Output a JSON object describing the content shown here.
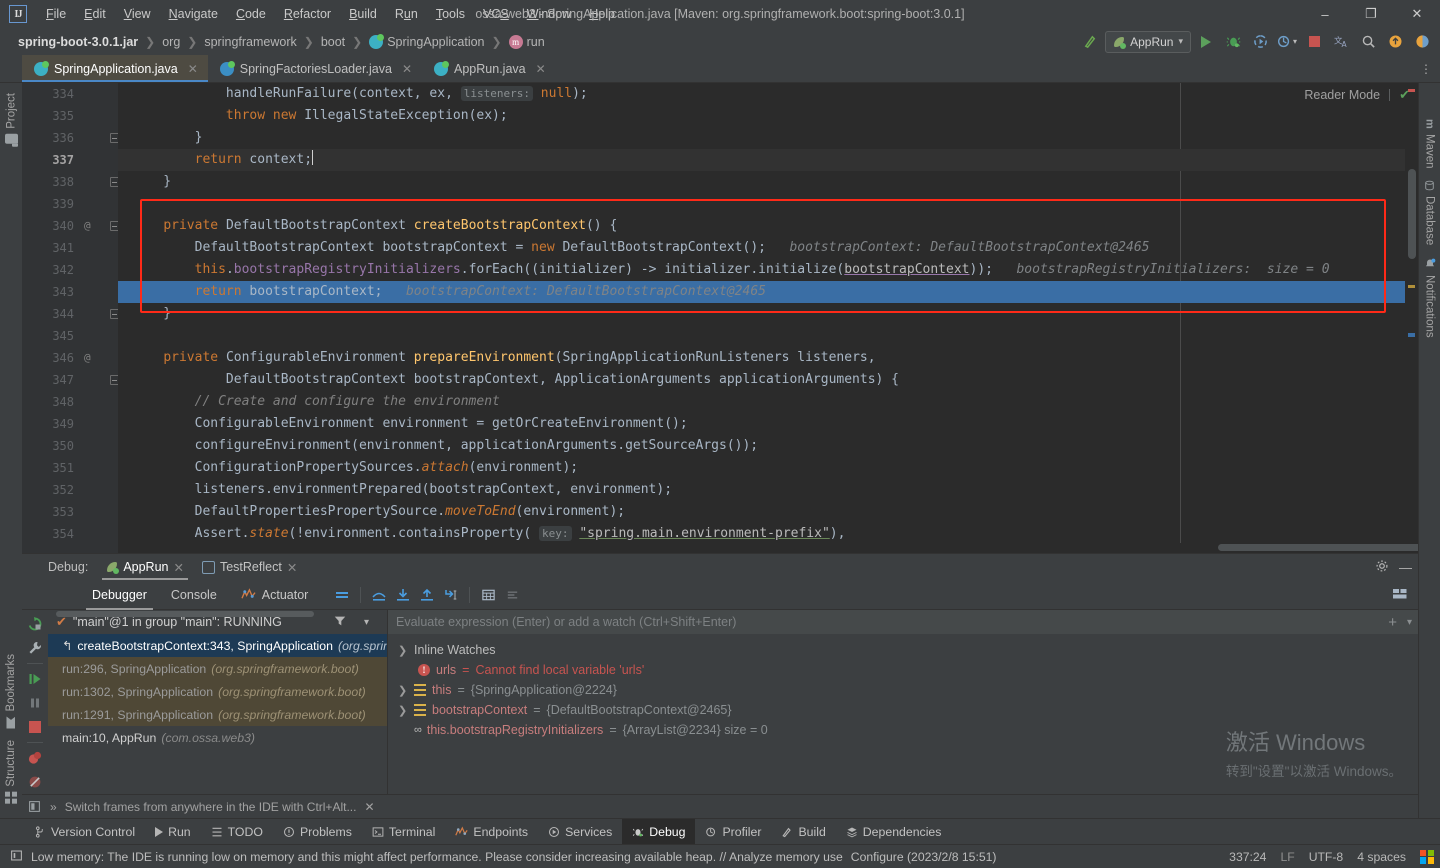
{
  "window": {
    "title": "ossa-web3 - SpringApplication.java [Maven: org.springframework.boot:spring-boot:3.0.1]",
    "logo": "IJ",
    "minimize": "–",
    "maximize": "❐",
    "close": "✕"
  },
  "menu": [
    {
      "label": "File",
      "mnemonic": "F"
    },
    {
      "label": "Edit",
      "mnemonic": "E"
    },
    {
      "label": "View",
      "mnemonic": "V"
    },
    {
      "label": "Navigate",
      "mnemonic": "N"
    },
    {
      "label": "Code",
      "mnemonic": "C"
    },
    {
      "label": "Refactor",
      "mnemonic": "R"
    },
    {
      "label": "Build",
      "mnemonic": "B"
    },
    {
      "label": "Run",
      "mnemonic": "u"
    },
    {
      "label": "Tools",
      "mnemonic": "T"
    },
    {
      "label": "VCS",
      "mnemonic": "S"
    },
    {
      "label": "Window",
      "mnemonic": "W"
    },
    {
      "label": "Help",
      "mnemonic": "H"
    }
  ],
  "breadcrumbs": [
    {
      "label": "spring-boot-3.0.1.jar",
      "icon": "",
      "bold": true
    },
    {
      "label": "org",
      "icon": ""
    },
    {
      "label": "springframework",
      "icon": ""
    },
    {
      "label": "boot",
      "icon": ""
    },
    {
      "label": "SpringApplication",
      "icon": "class-icon"
    },
    {
      "label": "run",
      "icon": "method-icon"
    }
  ],
  "toolbar": {
    "run_config": "AppRun",
    "dropdown_caret": "▾",
    "icons": [
      "build-hammer-icon",
      "run-icon",
      "debug-icon",
      "run-with-coverage-icon",
      "profiler-icon",
      "stop-icon",
      "translate-icon",
      "search-icon",
      "updates-icon",
      "ai-assistant-icon"
    ]
  },
  "editor_tabs": [
    {
      "label": "SpringApplication.java",
      "icon": "class-icon",
      "active": true,
      "close": "✕"
    },
    {
      "label": "SpringFactoriesLoader.java",
      "icon": "class-icon-blue",
      "active": false,
      "close": "✕"
    },
    {
      "label": "AppRun.java",
      "icon": "runnable-class-icon",
      "active": false,
      "close": "✕"
    }
  ],
  "editor": {
    "reader_mode": "Reader Mode",
    "reader_mode_check": "✔",
    "lines": [
      {
        "num": "334",
        "at": false,
        "fold": false,
        "segs": [
          {
            "t": "            handleRunFailure(context, ex, ",
            "c": "nrm"
          },
          {
            "t": "listeners:",
            "c": "param-hint"
          },
          {
            "t": " ",
            "c": "nrm"
          },
          {
            "t": "null",
            "c": "kw"
          },
          {
            "t": ");",
            "c": "nrm"
          }
        ]
      },
      {
        "num": "335",
        "at": false,
        "fold": false,
        "segs": [
          {
            "t": "            ",
            "c": "nrm"
          },
          {
            "t": "throw new ",
            "c": "kw"
          },
          {
            "t": "IllegalStateException(ex);",
            "c": "nrm"
          }
        ]
      },
      {
        "num": "336",
        "at": false,
        "fold": "end",
        "segs": [
          {
            "t": "        }",
            "c": "nrm"
          }
        ]
      },
      {
        "num": "337",
        "at": false,
        "fold": false,
        "current": true,
        "segs": [
          {
            "t": "        ",
            "c": "nrm"
          },
          {
            "t": "return ",
            "c": "kw"
          },
          {
            "t": "context;",
            "c": "nrm"
          },
          {
            "t": "|",
            "c": "caret"
          }
        ]
      },
      {
        "num": "338",
        "at": false,
        "fold": "end",
        "segs": [
          {
            "t": "    }",
            "c": "nrm"
          }
        ]
      },
      {
        "num": "339",
        "at": false,
        "fold": false,
        "segs": [
          {
            "t": "",
            "c": "nrm"
          }
        ]
      },
      {
        "num": "340",
        "at": true,
        "fold": "start",
        "segs": [
          {
            "t": "    ",
            "c": "nrm"
          },
          {
            "t": "private ",
            "c": "kw"
          },
          {
            "t": "DefaultBootstrapContext ",
            "c": "nrm"
          },
          {
            "t": "createBootstrapContext",
            "c": "mth"
          },
          {
            "t": "() {",
            "c": "nrm"
          }
        ]
      },
      {
        "num": "341",
        "at": false,
        "fold": false,
        "segs": [
          {
            "t": "        DefaultBootstrapContext bootstrapContext = ",
            "c": "nrm"
          },
          {
            "t": "new ",
            "c": "kw"
          },
          {
            "t": "DefaultBootstrapContext();",
            "c": "nrm"
          },
          {
            "t": "   bootstrapContext: DefaultBootstrapContext@2465",
            "c": "hint"
          }
        ]
      },
      {
        "num": "342",
        "at": false,
        "fold": false,
        "segs": [
          {
            "t": "        ",
            "c": "nrm"
          },
          {
            "t": "this",
            "c": "kw"
          },
          {
            "t": ".",
            "c": "nrm"
          },
          {
            "t": "bootstrapRegistryInitializers",
            "c": "fld"
          },
          {
            "t": ".forEach((initializer) -> initializer.initialize(",
            "c": "nrm"
          },
          {
            "t": "bootstrapContext",
            "c": "ulink"
          },
          {
            "t": "));",
            "c": "nrm"
          },
          {
            "t": "   bootstrapRegistryInitializers:  size = 0",
            "c": "hint"
          }
        ]
      },
      {
        "num": "343",
        "at": false,
        "fold": false,
        "selected": true,
        "segs": [
          {
            "t": "        ",
            "c": "nrm"
          },
          {
            "t": "return ",
            "c": "kw"
          },
          {
            "t": "bootstrapContext;",
            "c": "nrm"
          },
          {
            "t": "   bootstrapContext: DefaultBootstrapContext@2465",
            "c": "hint"
          }
        ]
      },
      {
        "num": "344",
        "at": false,
        "fold": "end",
        "segs": [
          {
            "t": "    }",
            "c": "nrm"
          }
        ]
      },
      {
        "num": "345",
        "at": false,
        "fold": false,
        "segs": [
          {
            "t": "",
            "c": "nrm"
          }
        ]
      },
      {
        "num": "346",
        "at": true,
        "fold": false,
        "segs": [
          {
            "t": "    ",
            "c": "nrm"
          },
          {
            "t": "private ",
            "c": "kw"
          },
          {
            "t": "ConfigurableEnvironment ",
            "c": "nrm"
          },
          {
            "t": "prepareEnvironment",
            "c": "mth"
          },
          {
            "t": "(SpringApplicationRunListeners listeners,",
            "c": "nrm"
          }
        ]
      },
      {
        "num": "347",
        "at": false,
        "fold": "start",
        "segs": [
          {
            "t": "            DefaultBootstrapContext bootstrapContext, ApplicationArguments applicationArguments) {",
            "c": "nrm"
          }
        ]
      },
      {
        "num": "348",
        "at": false,
        "fold": false,
        "segs": [
          {
            "t": "        ",
            "c": "nrm"
          },
          {
            "t": "// Create and configure the environment",
            "c": "cmt"
          }
        ]
      },
      {
        "num": "349",
        "at": false,
        "fold": false,
        "segs": [
          {
            "t": "        ConfigurableEnvironment environment = getOrCreateEnvironment();",
            "c": "nrm"
          }
        ]
      },
      {
        "num": "350",
        "at": false,
        "fold": false,
        "segs": [
          {
            "t": "        configureEnvironment(environment, applicationArguments.getSourceArgs());",
            "c": "nrm"
          }
        ]
      },
      {
        "num": "351",
        "at": false,
        "fold": false,
        "segs": [
          {
            "t": "        ConfigurationPropertySources.",
            "c": "nrm"
          },
          {
            "t": "attach",
            "c": "kw-it"
          },
          {
            "t": "(environment);",
            "c": "nrm"
          }
        ]
      },
      {
        "num": "352",
        "at": false,
        "fold": false,
        "segs": [
          {
            "t": "        listeners.environmentPrepared(bootstrapContext, environment);",
            "c": "nrm"
          }
        ]
      },
      {
        "num": "353",
        "at": false,
        "fold": false,
        "segs": [
          {
            "t": "        DefaultPropertiesPropertySource.",
            "c": "nrm"
          },
          {
            "t": "moveToEnd",
            "c": "kw-it"
          },
          {
            "t": "(environment);",
            "c": "nrm"
          }
        ]
      },
      {
        "num": "354",
        "at": false,
        "fold": false,
        "segs": [
          {
            "t": "        Assert.",
            "c": "nrm"
          },
          {
            "t": "state",
            "c": "kw-it"
          },
          {
            "t": "(!environment.containsProperty( ",
            "c": "nrm"
          },
          {
            "t": "key:",
            "c": "param-hint"
          },
          {
            "t": " ",
            "c": "nrm"
          },
          {
            "t": "\"spring.main.environment-prefix\"",
            "c": "ustr"
          },
          {
            "t": "),",
            "c": "nrm"
          }
        ]
      }
    ]
  },
  "debug": {
    "label": "Debug:",
    "session_tabs": [
      {
        "label": "AppRun",
        "icon": "spring-boot-icon",
        "active": true,
        "close": "✕"
      },
      {
        "label": "TestReflect",
        "icon": "java-app-icon",
        "active": false,
        "close": "✕"
      }
    ],
    "settings_icon": "gear-icon",
    "minimize_icon": "—",
    "inner_tabs": [
      {
        "label": "Debugger",
        "active": true
      },
      {
        "label": "Console",
        "active": false
      },
      {
        "label": "Actuator",
        "active": false,
        "icon": "actuator-icon"
      }
    ],
    "step_icons": [
      "show-execution-point-icon",
      "step-over-icon",
      "step-into-icon",
      "step-out-icon",
      "run-to-cursor-icon",
      "evaluate-icon",
      "mute-breakpoints-icon"
    ],
    "layout_icon": "layout-settings-icon",
    "rail_icons": [
      "rerun-icon",
      "settings-wrench-icon",
      "resume-icon",
      "pause-icon",
      "stop-icon",
      "view-breakpoints-icon",
      "mute-breakpoints-icon"
    ],
    "thread": {
      "check": "✔",
      "text": "\"main\"@1 in group \"main\": RUNNING",
      "filter_icon": "filter-icon",
      "dropdown": "▾"
    },
    "frames": [
      {
        "method": "createBootstrapContext:343, SpringApplication",
        "pkg": "(org.springframework.boot)",
        "selected": true,
        "icon": "current-frame-icon"
      },
      {
        "method": "run:296, SpringApplication",
        "pkg": "(org.springframework.boot)",
        "library": true
      },
      {
        "method": "run:1302, SpringApplication",
        "pkg": "(org.springframework.boot)",
        "library": true
      },
      {
        "method": "run:1291, SpringApplication",
        "pkg": "(org.springframework.boot)",
        "library": true
      },
      {
        "method": "main:10, AppRun",
        "pkg": "(com.ossa.web3)"
      }
    ],
    "evaluate_placeholder": "Evaluate expression (Enter) or add a watch (Ctrl+Shift+Enter)",
    "eval_add_icon": "+",
    "eval_dropdown": "▾",
    "variables": [
      {
        "expandable": true,
        "icon": "",
        "name": "Inline Watches",
        "eq": "",
        "value": "",
        "kind": "group"
      },
      {
        "expandable": false,
        "icon": "error-icon",
        "name": "urls",
        "eq": "=",
        "value": "Cannot find local variable 'urls'",
        "kind": "error"
      },
      {
        "expandable": true,
        "icon": "object-icon",
        "name": "this",
        "eq": "=",
        "value": "{SpringApplication@2224}",
        "kind": "object"
      },
      {
        "expandable": true,
        "icon": "object-icon",
        "name": "bootstrapContext",
        "eq": "=",
        "value": "{DefaultBootstrapContext@2465}",
        "kind": "object"
      },
      {
        "expandable": false,
        "icon": "watch-icon",
        "name": "this.bootstrapRegistryInitializers",
        "eq": "=",
        "value": "{ArrayList@2234}  size = 0",
        "kind": "watch"
      }
    ],
    "hint": {
      "expand": "»",
      "text": "Switch frames from anywhere in the IDE with Ctrl+Alt...",
      "close": "✕"
    }
  },
  "watermark": {
    "line1": "激活 Windows",
    "line2": "转到\"设置\"以激活 Windows。"
  },
  "left_rail": [
    {
      "label": "Project",
      "icon": "project-icon"
    },
    {
      "label": "Bookmarks",
      "icon": "bookmarks-icon"
    },
    {
      "label": "Structure",
      "icon": "structure-icon"
    }
  ],
  "right_rail": [
    {
      "label": "Maven",
      "icon": "maven-icon"
    },
    {
      "label": "Database",
      "icon": "database-icon"
    },
    {
      "label": "Notifications",
      "icon": "notifications-icon"
    }
  ],
  "toolwindow_bar": [
    {
      "label": "Version Control",
      "icon": "branch-icon",
      "active": false
    },
    {
      "label": "Run",
      "icon": "run-icon",
      "active": false
    },
    {
      "label": "TODO",
      "icon": "todo-icon",
      "active": false
    },
    {
      "label": "Problems",
      "icon": "problems-icon",
      "active": false
    },
    {
      "label": "Terminal",
      "icon": "terminal-icon",
      "active": false
    },
    {
      "label": "Endpoints",
      "icon": "endpoints-icon",
      "active": false
    },
    {
      "label": "Services",
      "icon": "services-icon",
      "active": false
    },
    {
      "label": "Debug",
      "icon": "debug-icon",
      "active": true
    },
    {
      "label": "Profiler",
      "icon": "profiler-icon",
      "active": false
    },
    {
      "label": "Build",
      "icon": "build-icon",
      "active": false
    },
    {
      "label": "Dependencies",
      "icon": "dependencies-icon",
      "active": false
    }
  ],
  "statusbar": {
    "icon": "memory-icon",
    "message": "Low memory: The IDE is running low on memory and this might affect performance. Please consider increasing available heap. // Analyze memory use",
    "configure": "Configure (2023/2/8 15:51)",
    "caret_position": "337:24",
    "line_separator": "LF",
    "encoding": "UTF-8",
    "indent": "4 spaces",
    "os_logo": "windows-logo-icon"
  },
  "colors": {
    "accent_blue": "#4a88c7",
    "selection_blue": "#3a6ea5",
    "highlight_red": "#ff2a18",
    "keyword_orange": "#cc7832",
    "method_yellow": "#ffc66d",
    "field_purple": "#9876aa",
    "string_green": "#6a8759",
    "editor_bg": "#2b2b2b",
    "panel_bg": "#3c3f41"
  }
}
